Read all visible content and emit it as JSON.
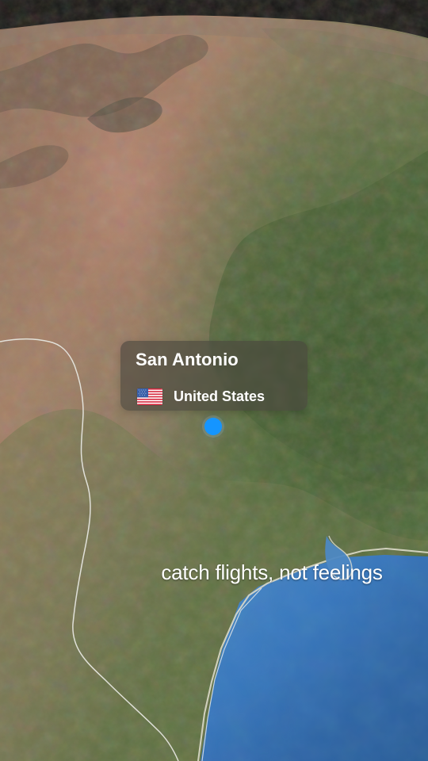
{
  "location_card": {
    "city": "San Antonio",
    "country": "United States",
    "flag_icon": "us-flag-icon"
  },
  "map": {
    "location_marker_icon": "location-dot-icon",
    "marker_color": "#1595FF",
    "water_color": "#3B79C1",
    "terrain_colors": {
      "desert": "#9D7C62",
      "vegetation": "#556E3D",
      "mountains": "#6B584A"
    }
  },
  "caption": {
    "text": "catch flights, not feelings"
  }
}
